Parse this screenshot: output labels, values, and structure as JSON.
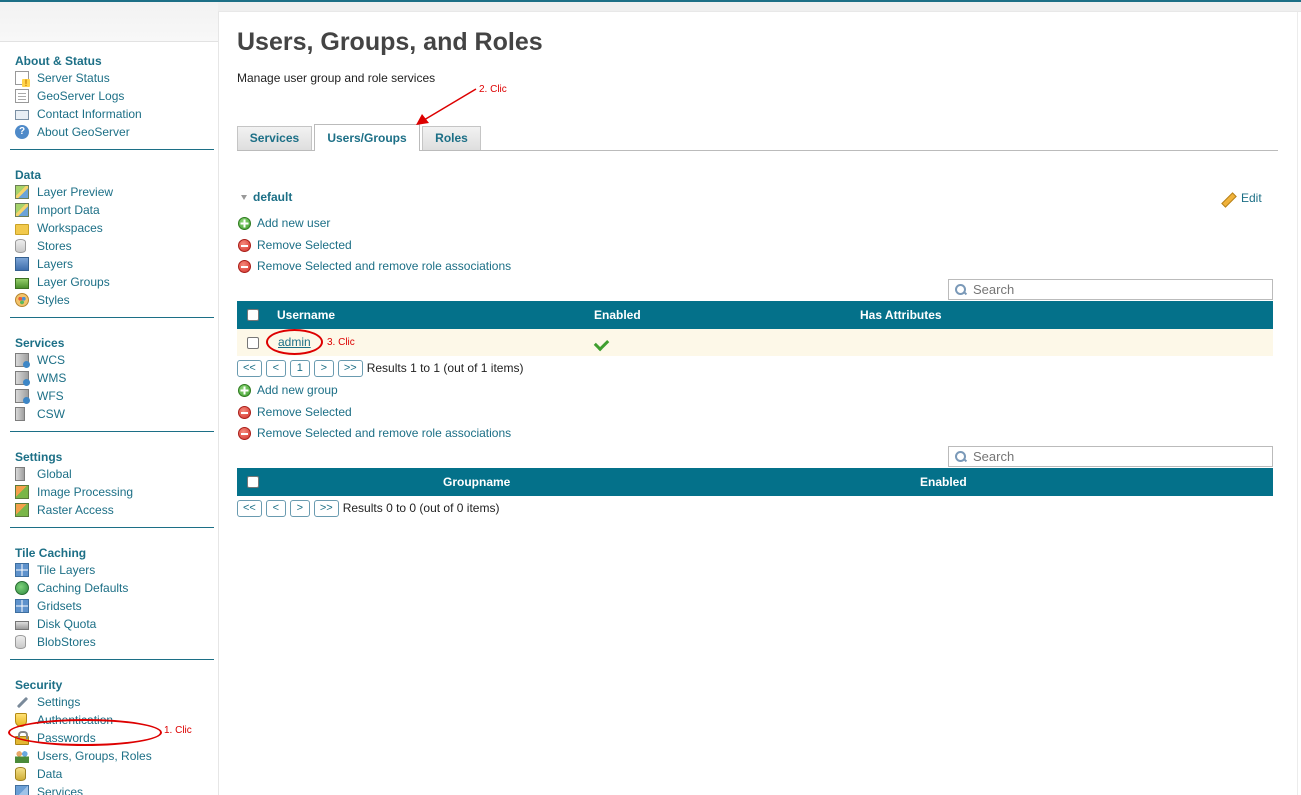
{
  "sidebar": {
    "sections": [
      {
        "title": "About & Status",
        "items": [
          {
            "label": "Server Status",
            "icon": "warning-doc-icon"
          },
          {
            "label": "GeoServer Logs",
            "icon": "document-icon"
          },
          {
            "label": "Contact Information",
            "icon": "contact-card-icon"
          },
          {
            "label": "About GeoServer",
            "icon": "help-icon"
          }
        ]
      },
      {
        "title": "Data",
        "items": [
          {
            "label": "Layer Preview",
            "icon": "map-icon"
          },
          {
            "label": "Import Data",
            "icon": "map-import-icon"
          },
          {
            "label": "Workspaces",
            "icon": "folder-icon"
          },
          {
            "label": "Stores",
            "icon": "database-icon"
          },
          {
            "label": "Layers",
            "icon": "layer-icon"
          },
          {
            "label": "Layer Groups",
            "icon": "layer-group-icon"
          },
          {
            "label": "Styles",
            "icon": "palette-icon"
          }
        ]
      },
      {
        "title": "Services",
        "items": [
          {
            "label": "WCS",
            "icon": "server-globe-icon"
          },
          {
            "label": "WMS",
            "icon": "server-globe-icon"
          },
          {
            "label": "WFS",
            "icon": "server-globe-icon"
          },
          {
            "label": "CSW",
            "icon": "server-icon"
          }
        ]
      },
      {
        "title": "Settings",
        "items": [
          {
            "label": "Global",
            "icon": "server-icon"
          },
          {
            "label": "Image Processing",
            "icon": "image-icon"
          },
          {
            "label": "Raster Access",
            "icon": "image-icon"
          }
        ]
      },
      {
        "title": "Tile Caching",
        "items": [
          {
            "label": "Tile Layers",
            "icon": "grid-icon"
          },
          {
            "label": "Caching Defaults",
            "icon": "globe-icon"
          },
          {
            "label": "Gridsets",
            "icon": "grid-icon"
          },
          {
            "label": "Disk Quota",
            "icon": "disk-icon"
          },
          {
            "label": "BlobStores",
            "icon": "database-icon"
          }
        ]
      },
      {
        "title": "Security",
        "items": [
          {
            "label": "Settings",
            "icon": "wrench-icon"
          },
          {
            "label": "Authentication",
            "icon": "shield-icon"
          },
          {
            "label": "Passwords",
            "icon": "lock-icon"
          },
          {
            "label": "Users, Groups, Roles",
            "icon": "users-icon"
          },
          {
            "label": "Data",
            "icon": "data-security-icon"
          },
          {
            "label": "Services",
            "icon": "services-security-icon"
          }
        ]
      }
    ]
  },
  "page": {
    "title": "Users, Groups, and Roles",
    "description": "Manage user group and role services"
  },
  "tabs": [
    {
      "label": "Services"
    },
    {
      "label": "Users/Groups",
      "active": true
    },
    {
      "label": "Roles"
    }
  ],
  "service": {
    "name": "default",
    "edit_label": "Edit"
  },
  "users": {
    "actions": {
      "add": "Add new user",
      "remove": "Remove Selected",
      "remove_roles": "Remove Selected and remove role associations"
    },
    "search_placeholder": "Search",
    "columns": [
      "Username",
      "Enabled",
      "Has Attributes"
    ],
    "rows": [
      {
        "username": "admin",
        "enabled": true,
        "has_attributes": ""
      }
    ],
    "pager": {
      "first": "<<",
      "prev": "<",
      "page": "1",
      "next": ">",
      "last": ">>",
      "results": "Results 1 to 1 (out of 1 items)"
    }
  },
  "groups": {
    "actions": {
      "add": "Add new group",
      "remove": "Remove Selected",
      "remove_roles": "Remove Selected and remove role associations"
    },
    "search_placeholder": "Search",
    "columns": [
      "Groupname",
      "Enabled"
    ],
    "rows": [],
    "pager": {
      "first": "<<",
      "prev": "<",
      "next": ">",
      "last": ">>",
      "results": "Results 0 to 0 (out of 0 items)"
    }
  },
  "annotations": {
    "step1": "1. Clic",
    "step2": "2. Clic",
    "step3": "3. Clic",
    "color": "#dd0000"
  },
  "colors": {
    "accent": "#1c6f86",
    "table_header": "#04718a",
    "row_highlight": "#fdf8e8"
  }
}
